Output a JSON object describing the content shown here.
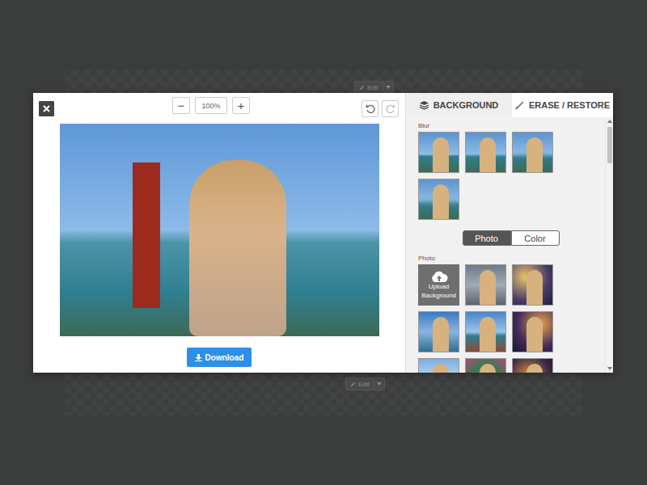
{
  "backdrop": {
    "edit_buttons": [
      {
        "label": "Edit"
      },
      {
        "label": "Edit"
      }
    ]
  },
  "zoom": {
    "minus": "−",
    "value": "100%",
    "plus": "+"
  },
  "download": {
    "label": "Download"
  },
  "tabs": [
    {
      "label": "BACKGROUND",
      "selected": true
    },
    {
      "label": "ERASE / RESTORE",
      "selected": false
    }
  ],
  "blur": {
    "label": "Blur",
    "options": [
      {
        "selected": false
      },
      {
        "selected": false
      },
      {
        "selected": false
      },
      {
        "selected": false
      }
    ]
  },
  "mode_toggle": [
    {
      "label": "Photo",
      "selected": true
    },
    {
      "label": "Color",
      "selected": false
    }
  ],
  "photos": {
    "label": "Photo",
    "items": [
      {
        "kind": "upload",
        "label": "Upload Background"
      },
      {
        "kind": "photo"
      },
      {
        "kind": "photo"
      },
      {
        "kind": "photo"
      },
      {
        "kind": "photo"
      },
      {
        "kind": "photo"
      },
      {
        "kind": "photo"
      },
      {
        "kind": "photo"
      },
      {
        "kind": "photo"
      }
    ]
  }
}
